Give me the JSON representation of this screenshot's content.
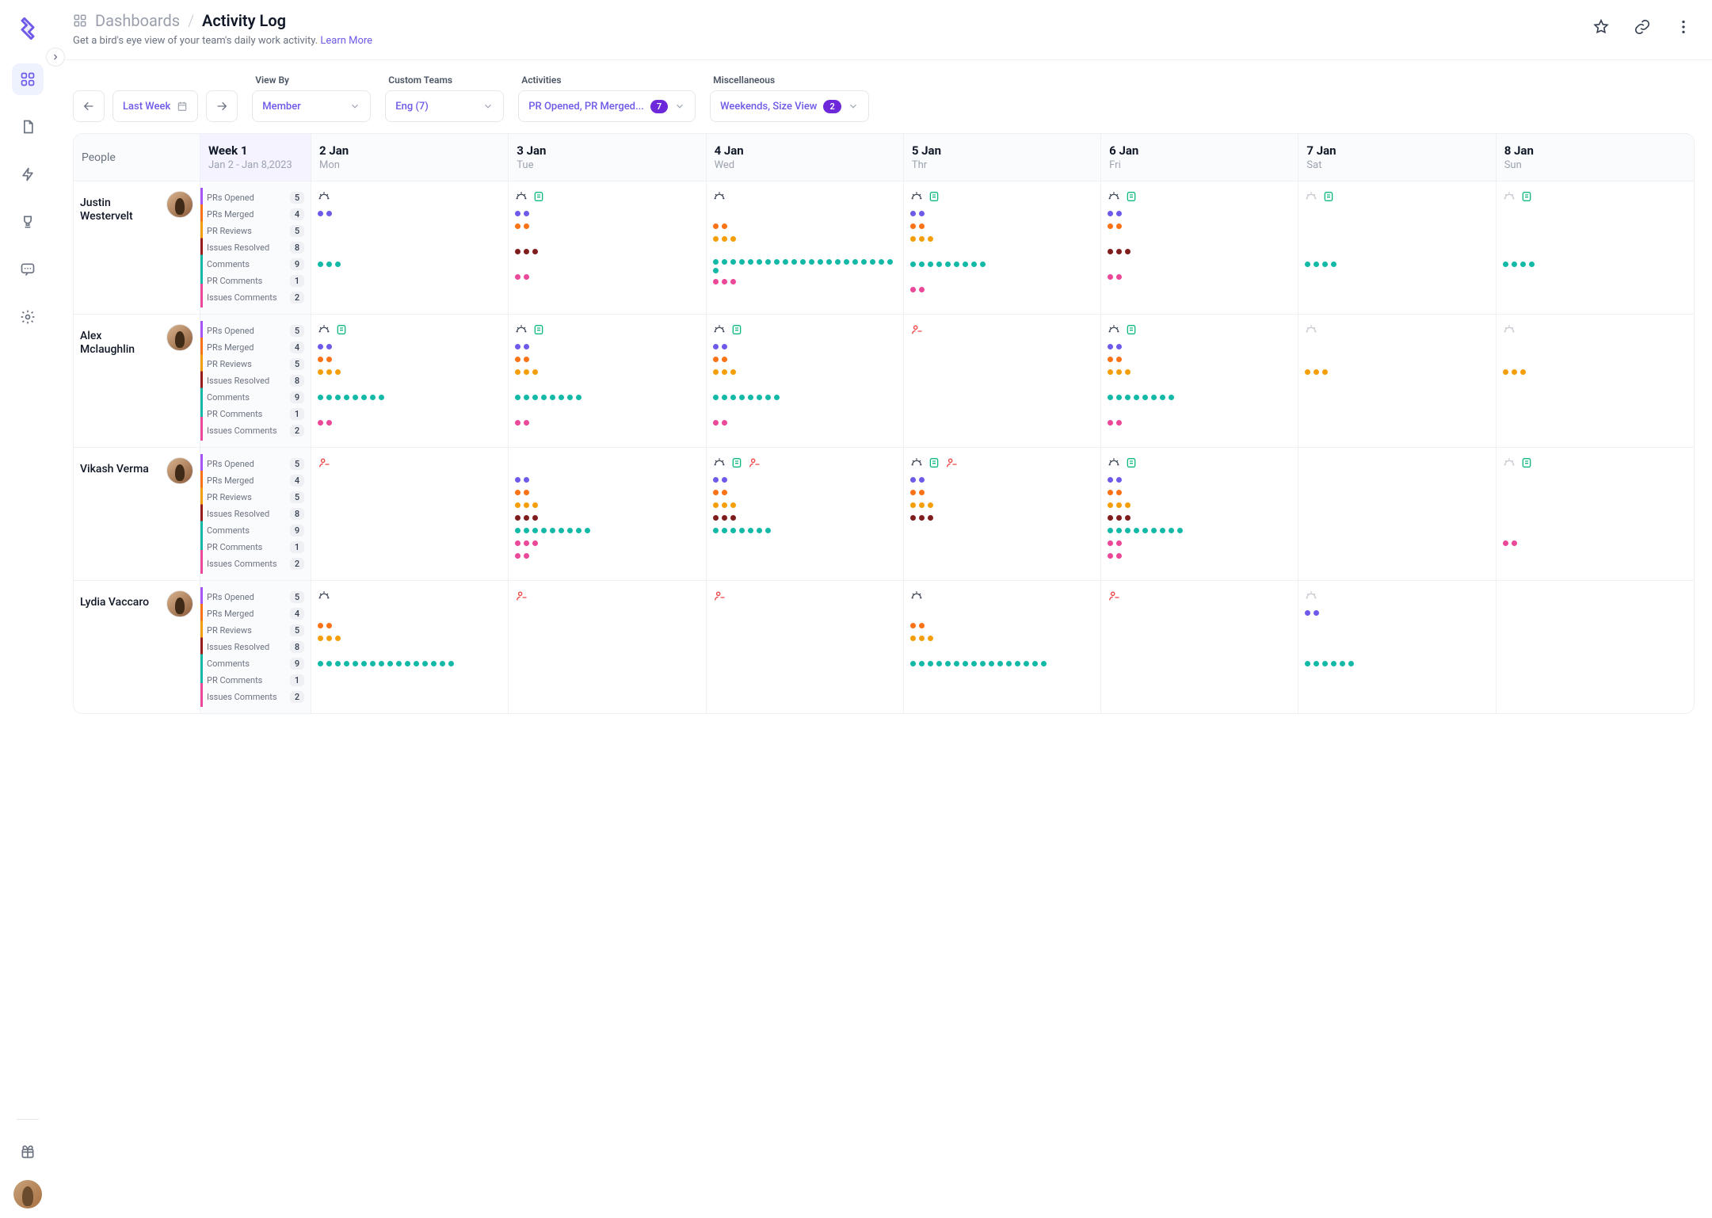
{
  "breadcrumb": {
    "root": "Dashboards",
    "current": "Activity Log"
  },
  "subtitle": {
    "text": "Get a bird's eye view of your team's daily work activity. ",
    "link": "Learn More"
  },
  "nav": {
    "dashboards": "Dashboards",
    "docs": "Docs",
    "activity": "Activity",
    "goals": "Goals",
    "chat": "Chat",
    "settings": "Settings",
    "gift": "Gift"
  },
  "filters": {
    "range": "Last Week",
    "viewby": {
      "label": "View By",
      "value": "Member"
    },
    "teams": {
      "label": "Custom Teams",
      "value": "Eng (7)"
    },
    "acts": {
      "label": "Activities",
      "value": "PR Opened, PR Merged...",
      "count": "7"
    },
    "misc": {
      "label": "Miscellaneous",
      "value": "Weekends, Size View",
      "count": "2"
    }
  },
  "columns": {
    "people": "People",
    "week": {
      "title": "Week 1",
      "sub": "Jan 2 - Jan 8,2023"
    },
    "days": [
      {
        "d": "2 Jan",
        "w": "Mon"
      },
      {
        "d": "3 Jan",
        "w": "Tue"
      },
      {
        "d": "4 Jan",
        "w": "Wed"
      },
      {
        "d": "5 Jan",
        "w": "Thr"
      },
      {
        "d": "6 Jan",
        "w": "Fri"
      },
      {
        "d": "7 Jan",
        "w": "Sat"
      },
      {
        "d": "8 Jan",
        "w": "Sun"
      }
    ]
  },
  "metrics": [
    {
      "key": "po",
      "label": "PRs Opened"
    },
    {
      "key": "pm",
      "label": "PRs Merged"
    },
    {
      "key": "pr",
      "label": "PR Reviews"
    },
    {
      "key": "ir",
      "label": "Issues Resolved"
    },
    {
      "key": "cm",
      "label": "Comments"
    },
    {
      "key": "pc",
      "label": "PR Comments"
    },
    {
      "key": "ic",
      "label": "Issues Comments"
    }
  ],
  "people": [
    {
      "name": "Justin Westervelt",
      "summary": {
        "po": "5",
        "pm": "4",
        "pr": "5",
        "ir": "8",
        "cm": "9",
        "pc": "1",
        "ic": "2"
      },
      "days": [
        {
          "icons": [
            "sun"
          ],
          "acts": {
            "po": 2,
            "pm": 0,
            "pr": 0,
            "ir": 0,
            "cm": 3,
            "pc": 0,
            "ic": 0
          }
        },
        {
          "icons": [
            "sun",
            "note"
          ],
          "acts": {
            "po": 2,
            "pm": 2,
            "pr": 0,
            "ir": 3,
            "cm": 0,
            "pc": 2,
            "ic": 0
          }
        },
        {
          "icons": [
            "sun"
          ],
          "acts": {
            "po": 0,
            "pm": 2,
            "pr": 3,
            "ir": 0,
            "cm": 22,
            "pc": 3,
            "ic": 0
          }
        },
        {
          "icons": [
            "sun",
            "note"
          ],
          "acts": {
            "po": 2,
            "pm": 2,
            "pr": 3,
            "ir": 0,
            "cm": 9,
            "pc": 0,
            "ic": 2
          }
        },
        {
          "icons": [
            "sun",
            "note"
          ],
          "acts": {
            "po": 2,
            "pm": 2,
            "pr": 0,
            "ir": 3,
            "cm": 0,
            "pc": 2,
            "ic": 0
          }
        },
        {
          "icons": [
            "sun-g",
            "note"
          ],
          "acts": {
            "po": 0,
            "pm": 0,
            "pr": 0,
            "ir": 0,
            "cm": 4,
            "pc": 0,
            "ic": 0
          }
        },
        {
          "icons": [
            "sun-g",
            "note"
          ],
          "acts": {
            "po": 0,
            "pm": 0,
            "pr": 0,
            "ir": 0,
            "cm": 4,
            "pc": 0,
            "ic": 0
          }
        }
      ]
    },
    {
      "name": "Alex Mclaughlin",
      "summary": {
        "po": "5",
        "pm": "4",
        "pr": "5",
        "ir": "8",
        "cm": "9",
        "pc": "1",
        "ic": "2"
      },
      "days": [
        {
          "icons": [
            "sun",
            "note"
          ],
          "acts": {
            "po": 2,
            "pm": 2,
            "pr": 3,
            "ir": 0,
            "cm": 8,
            "pc": 0,
            "ic": 2
          }
        },
        {
          "icons": [
            "sun",
            "note"
          ],
          "acts": {
            "po": 2,
            "pm": 2,
            "pr": 3,
            "ir": 0,
            "cm": 8,
            "pc": 0,
            "ic": 2
          }
        },
        {
          "icons": [
            "sun",
            "note"
          ],
          "acts": {
            "po": 2,
            "pm": 2,
            "pr": 3,
            "ir": 0,
            "cm": 8,
            "pc": 0,
            "ic": 2
          }
        },
        {
          "icons": [
            "absent"
          ],
          "acts": {}
        },
        {
          "icons": [
            "sun",
            "note"
          ],
          "acts": {
            "po": 2,
            "pm": 2,
            "pr": 3,
            "ir": 0,
            "cm": 8,
            "pc": 0,
            "ic": 2
          }
        },
        {
          "icons": [
            "sun-g"
          ],
          "acts": {
            "po": 0,
            "pm": 0,
            "pr": 3,
            "ir": 0,
            "cm": 0,
            "pc": 0,
            "ic": 0
          }
        },
        {
          "icons": [
            "sun-g"
          ],
          "acts": {
            "po": 0,
            "pm": 0,
            "pr": 3,
            "ir": 0,
            "cm": 0,
            "pc": 0,
            "ic": 0
          }
        }
      ]
    },
    {
      "name": "Vikash Verma",
      "summary": {
        "po": "5",
        "pm": "4",
        "pr": "5",
        "ir": "8",
        "cm": "9",
        "pc": "1",
        "ic": "2"
      },
      "days": [
        {
          "icons": [
            "absent"
          ],
          "acts": {}
        },
        {
          "icons": [],
          "acts": {
            "po": 2,
            "pm": 2,
            "pr": 3,
            "ir": 3,
            "cm": 9,
            "pc": 3,
            "ic": 2
          }
        },
        {
          "icons": [
            "sun",
            "note",
            "absent"
          ],
          "acts": {
            "po": 2,
            "pm": 2,
            "pr": 3,
            "ir": 3,
            "cm": 7,
            "pc": 0,
            "ic": 0
          }
        },
        {
          "icons": [
            "sun",
            "note",
            "absent"
          ],
          "acts": {
            "po": 2,
            "pm": 2,
            "pr": 3,
            "ir": 3,
            "cm": 0,
            "pc": 0,
            "ic": 0
          }
        },
        {
          "icons": [
            "sun",
            "note"
          ],
          "acts": {
            "po": 2,
            "pm": 2,
            "pr": 3,
            "ir": 3,
            "cm": 9,
            "pc": 2,
            "ic": 2
          }
        },
        {
          "icons": [],
          "acts": {}
        },
        {
          "icons": [
            "sun-g",
            "note"
          ],
          "acts": {
            "po": 0,
            "pm": 0,
            "pr": 0,
            "ir": 0,
            "cm": 0,
            "pc": 2,
            "ic": 0
          }
        }
      ]
    },
    {
      "name": "Lydia Vaccaro",
      "summary": {
        "po": "5",
        "pm": "4",
        "pr": "5",
        "ir": "8",
        "cm": "9",
        "pc": "1",
        "ic": "2"
      },
      "days": [
        {
          "icons": [
            "sun"
          ],
          "acts": {
            "po": 0,
            "pm": 2,
            "pr": 3,
            "ir": 0,
            "cm": 16,
            "pc": 0,
            "ic": 0
          }
        },
        {
          "icons": [
            "absent"
          ],
          "acts": {}
        },
        {
          "icons": [
            "absent"
          ],
          "acts": {}
        },
        {
          "icons": [
            "sun"
          ],
          "acts": {
            "po": 0,
            "pm": 2,
            "pr": 3,
            "ir": 0,
            "cm": 16,
            "pc": 0,
            "ic": 0
          }
        },
        {
          "icons": [
            "absent"
          ],
          "acts": {}
        },
        {
          "icons": [
            "sun-g"
          ],
          "acts": {
            "po": 2,
            "pm": 0,
            "pr": 0,
            "ir": 0,
            "cm": 6,
            "pc": 0,
            "ic": 0
          }
        },
        {
          "icons": [],
          "acts": {}
        }
      ]
    }
  ]
}
